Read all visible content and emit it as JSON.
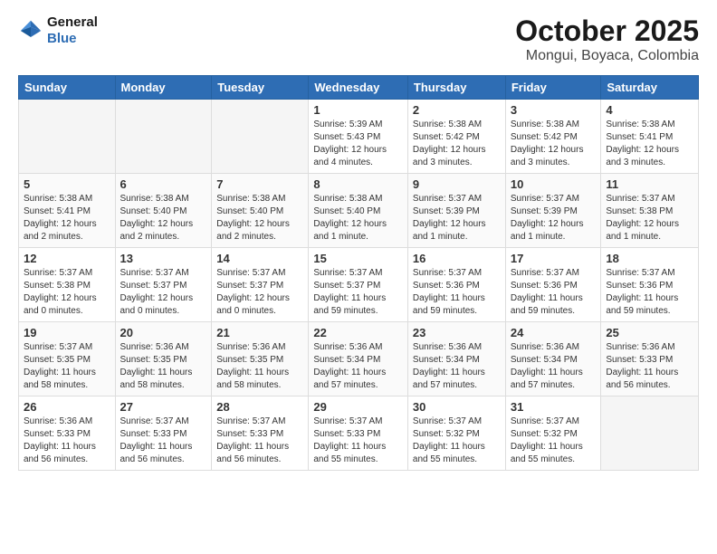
{
  "header": {
    "logo_line1": "General",
    "logo_line2": "Blue",
    "month": "October 2025",
    "location": "Mongui, Boyaca, Colombia"
  },
  "weekdays": [
    "Sunday",
    "Monday",
    "Tuesday",
    "Wednesday",
    "Thursday",
    "Friday",
    "Saturday"
  ],
  "weeks": [
    [
      {
        "day": "",
        "info": ""
      },
      {
        "day": "",
        "info": ""
      },
      {
        "day": "",
        "info": ""
      },
      {
        "day": "1",
        "info": "Sunrise: 5:39 AM\nSunset: 5:43 PM\nDaylight: 12 hours\nand 4 minutes."
      },
      {
        "day": "2",
        "info": "Sunrise: 5:38 AM\nSunset: 5:42 PM\nDaylight: 12 hours\nand 3 minutes."
      },
      {
        "day": "3",
        "info": "Sunrise: 5:38 AM\nSunset: 5:42 PM\nDaylight: 12 hours\nand 3 minutes."
      },
      {
        "day": "4",
        "info": "Sunrise: 5:38 AM\nSunset: 5:41 PM\nDaylight: 12 hours\nand 3 minutes."
      }
    ],
    [
      {
        "day": "5",
        "info": "Sunrise: 5:38 AM\nSunset: 5:41 PM\nDaylight: 12 hours\nand 2 minutes."
      },
      {
        "day": "6",
        "info": "Sunrise: 5:38 AM\nSunset: 5:40 PM\nDaylight: 12 hours\nand 2 minutes."
      },
      {
        "day": "7",
        "info": "Sunrise: 5:38 AM\nSunset: 5:40 PM\nDaylight: 12 hours\nand 2 minutes."
      },
      {
        "day": "8",
        "info": "Sunrise: 5:38 AM\nSunset: 5:40 PM\nDaylight: 12 hours\nand 1 minute."
      },
      {
        "day": "9",
        "info": "Sunrise: 5:37 AM\nSunset: 5:39 PM\nDaylight: 12 hours\nand 1 minute."
      },
      {
        "day": "10",
        "info": "Sunrise: 5:37 AM\nSunset: 5:39 PM\nDaylight: 12 hours\nand 1 minute."
      },
      {
        "day": "11",
        "info": "Sunrise: 5:37 AM\nSunset: 5:38 PM\nDaylight: 12 hours\nand 1 minute."
      }
    ],
    [
      {
        "day": "12",
        "info": "Sunrise: 5:37 AM\nSunset: 5:38 PM\nDaylight: 12 hours\nand 0 minutes."
      },
      {
        "day": "13",
        "info": "Sunrise: 5:37 AM\nSunset: 5:37 PM\nDaylight: 12 hours\nand 0 minutes."
      },
      {
        "day": "14",
        "info": "Sunrise: 5:37 AM\nSunset: 5:37 PM\nDaylight: 12 hours\nand 0 minutes."
      },
      {
        "day": "15",
        "info": "Sunrise: 5:37 AM\nSunset: 5:37 PM\nDaylight: 11 hours\nand 59 minutes."
      },
      {
        "day": "16",
        "info": "Sunrise: 5:37 AM\nSunset: 5:36 PM\nDaylight: 11 hours\nand 59 minutes."
      },
      {
        "day": "17",
        "info": "Sunrise: 5:37 AM\nSunset: 5:36 PM\nDaylight: 11 hours\nand 59 minutes."
      },
      {
        "day": "18",
        "info": "Sunrise: 5:37 AM\nSunset: 5:36 PM\nDaylight: 11 hours\nand 59 minutes."
      }
    ],
    [
      {
        "day": "19",
        "info": "Sunrise: 5:37 AM\nSunset: 5:35 PM\nDaylight: 11 hours\nand 58 minutes."
      },
      {
        "day": "20",
        "info": "Sunrise: 5:36 AM\nSunset: 5:35 PM\nDaylight: 11 hours\nand 58 minutes."
      },
      {
        "day": "21",
        "info": "Sunrise: 5:36 AM\nSunset: 5:35 PM\nDaylight: 11 hours\nand 58 minutes."
      },
      {
        "day": "22",
        "info": "Sunrise: 5:36 AM\nSunset: 5:34 PM\nDaylight: 11 hours\nand 57 minutes."
      },
      {
        "day": "23",
        "info": "Sunrise: 5:36 AM\nSunset: 5:34 PM\nDaylight: 11 hours\nand 57 minutes."
      },
      {
        "day": "24",
        "info": "Sunrise: 5:36 AM\nSunset: 5:34 PM\nDaylight: 11 hours\nand 57 minutes."
      },
      {
        "day": "25",
        "info": "Sunrise: 5:36 AM\nSunset: 5:33 PM\nDaylight: 11 hours\nand 56 minutes."
      }
    ],
    [
      {
        "day": "26",
        "info": "Sunrise: 5:36 AM\nSunset: 5:33 PM\nDaylight: 11 hours\nand 56 minutes."
      },
      {
        "day": "27",
        "info": "Sunrise: 5:37 AM\nSunset: 5:33 PM\nDaylight: 11 hours\nand 56 minutes."
      },
      {
        "day": "28",
        "info": "Sunrise: 5:37 AM\nSunset: 5:33 PM\nDaylight: 11 hours\nand 56 minutes."
      },
      {
        "day": "29",
        "info": "Sunrise: 5:37 AM\nSunset: 5:33 PM\nDaylight: 11 hours\nand 55 minutes."
      },
      {
        "day": "30",
        "info": "Sunrise: 5:37 AM\nSunset: 5:32 PM\nDaylight: 11 hours\nand 55 minutes."
      },
      {
        "day": "31",
        "info": "Sunrise: 5:37 AM\nSunset: 5:32 PM\nDaylight: 11 hours\nand 55 minutes."
      },
      {
        "day": "",
        "info": ""
      }
    ]
  ]
}
